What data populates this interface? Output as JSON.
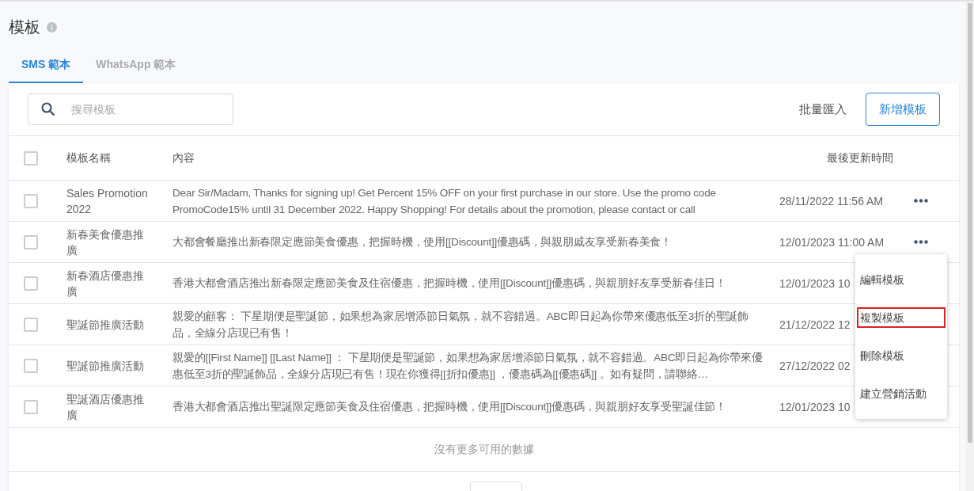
{
  "page": {
    "title": "模板"
  },
  "tabs": [
    {
      "label": "SMS 範本",
      "selected": true
    },
    {
      "label": "WhatsApp 範本",
      "selected": false
    }
  ],
  "toolbar": {
    "search": {
      "placeholder": "搜尋模板"
    },
    "import_link": "批量匯入",
    "add_button": "新增模板"
  },
  "table": {
    "select_all_checked": false,
    "columns": [
      "模板名稱",
      "內容",
      "最後更新時間"
    ],
    "rows": [
      {
        "checked": false,
        "name": "Sales Promotion 2022",
        "content": "Dear Sir/Madam, Thanks for signing up! Get Percent 15% OFF on your first purchase in our store. Use the promo code PromoCode15% until 31 December 2022. Happy Shopping! For details about the promotion, please contact or call",
        "updated": "28/11/2022 11:56 AM"
      },
      {
        "checked": false,
        "name": "新春美食優惠推廣",
        "content": "大都會餐廳推出新春限定應節美食優惠，把握時機，使用[[Discount]]優惠碼，與親朋戚友享受新春美食！",
        "updated": "12/01/2023 11:00 AM"
      },
      {
        "checked": false,
        "name": "新春酒店優惠推廣",
        "content": "香港大都會酒店推出新春限定應節美食及住宿優惠，把握時機，使用[[Discount]]優惠碼，與親朋好友享受新春佳日！",
        "updated": "12/01/2023 10"
      },
      {
        "checked": false,
        "name": "聖誕節推廣活動",
        "content": "親愛的顧客： 下星期便是聖誕節，如果想為家居增添節日氣氛，就不容錯過。ABC即日起為你帶來優惠低至3折的聖誕飾品，全線分店現已有售！",
        "updated": "21/12/2022 12"
      },
      {
        "checked": false,
        "name": "聖誕節推廣活動",
        "content": "親愛的[[First Name]] [[Last Name]] ： 下星期便是聖誕節，如果想為家居增添節日氣氛，就不容錯過。ABC即日起為你帶來優惠低至3折的聖誕飾品，全線分店現已有售！現在你獲得[[折扣優惠]] ，優惠碼為[[優惠碼]] 。如有疑問，請聯絡…",
        "updated": "27/12/2022 02"
      },
      {
        "checked": false,
        "name": "聖誕酒店優惠推廣",
        "content": "香港大都會酒店推出聖誕限定應節美食及住宿優惠，把握時機，使用[[Discount]]優惠碼，與親朋好友享受聖誕佳節！",
        "updated": "12/01/2023 10"
      }
    ],
    "empty_message": "沒有更多可用的數據"
  },
  "context_menu": {
    "items": [
      {
        "label": "編輯模板",
        "highlighted": false
      },
      {
        "label": "複製模板",
        "highlighted": true
      },
      {
        "label": "刪除模板",
        "highlighted": false
      },
      {
        "label": "建立營銷活動",
        "highlighted": false
      }
    ]
  }
}
